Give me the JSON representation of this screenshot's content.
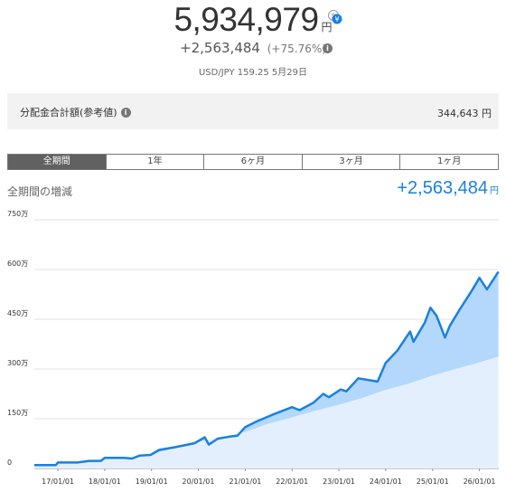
{
  "header": {
    "total_value": "5,934,979",
    "total_unit": "円",
    "gain": "+2,563,484",
    "gain_pct": "(+75.76%)",
    "fx_rate": "USD/JPY 159.25 5月29日",
    "currency_toggle_icon": "yen-dollar-toggle-icon",
    "info_icon": "info-icon"
  },
  "distribution": {
    "label": "分配金合計額(参考値)",
    "amount": "344,643 円"
  },
  "tabs": [
    {
      "label": "全期間",
      "active": true
    },
    {
      "label": "1年",
      "active": false
    },
    {
      "label": "6ヶ月",
      "active": false
    },
    {
      "label": "3ヶ月",
      "active": false
    },
    {
      "label": "1ヶ月",
      "active": false
    }
  ],
  "section": {
    "title": "全期間の増減",
    "value": "+2,563,484",
    "unit": "円"
  },
  "colors": {
    "accent": "#1a80e0",
    "line": "#1a80e0",
    "gain_fill": "#b3d8fb",
    "cost_fill": "#e3effc",
    "tab_active": "#616161"
  },
  "chart_data": {
    "type": "area",
    "y_ticks": [
      "750万",
      "600万",
      "450万",
      "300万",
      "150万",
      "0"
    ],
    "y_tick_values": [
      7500000,
      6000000,
      4500000,
      3000000,
      1500000,
      0
    ],
    "ylim": [
      0,
      7500000
    ],
    "x_ticks": [
      "17/01/01",
      "18/01/01",
      "19/01/01",
      "20/01/01",
      "21/01/01",
      "22/01/01",
      "23/01/01",
      "24/01/01",
      "25/01/01",
      "26/01/01"
    ],
    "x_range": [
      "2016-07-01",
      "2026-06-01"
    ],
    "grid": true,
    "series": [
      {
        "role": "valuation",
        "points": [
          [
            "2016-07-01",
            100000
          ],
          [
            "2016-12-15",
            100000
          ],
          [
            "2017-01-01",
            180000
          ],
          [
            "2017-06-01",
            180000
          ],
          [
            "2017-09-01",
            230000
          ],
          [
            "2017-12-01",
            230000
          ],
          [
            "2018-01-01",
            320000
          ],
          [
            "2018-06-01",
            320000
          ],
          [
            "2018-08-01",
            300000
          ],
          [
            "2018-10-01",
            390000
          ],
          [
            "2018-12-25",
            410000
          ],
          [
            "2019-03-01",
            560000
          ],
          [
            "2019-07-01",
            640000
          ],
          [
            "2019-12-01",
            760000
          ],
          [
            "2020-01-15",
            860000
          ],
          [
            "2020-02-20",
            940000
          ],
          [
            "2020-03-23",
            720000
          ],
          [
            "2020-06-01",
            900000
          ],
          [
            "2020-09-01",
            960000
          ],
          [
            "2020-11-01",
            990000
          ],
          [
            "2021-01-01",
            1250000
          ],
          [
            "2021-04-01",
            1420000
          ],
          [
            "2021-08-01",
            1620000
          ],
          [
            "2021-12-31",
            1850000
          ],
          [
            "2022-03-01",
            1760000
          ],
          [
            "2022-06-15",
            1980000
          ],
          [
            "2022-09-01",
            2250000
          ],
          [
            "2022-10-15",
            2150000
          ],
          [
            "2023-01-15",
            2380000
          ],
          [
            "2023-03-01",
            2330000
          ],
          [
            "2023-06-01",
            2720000
          ],
          [
            "2023-10-30",
            2620000
          ],
          [
            "2024-01-01",
            3180000
          ],
          [
            "2024-03-31",
            3550000
          ],
          [
            "2024-07-10",
            4130000
          ],
          [
            "2024-08-05",
            3820000
          ],
          [
            "2024-11-01",
            4400000
          ],
          [
            "2024-12-15",
            4850000
          ],
          [
            "2025-02-01",
            4600000
          ],
          [
            "2025-04-08",
            3950000
          ],
          [
            "2025-05-15",
            4300000
          ],
          [
            "2025-08-01",
            4800000
          ],
          [
            "2025-11-01",
            5350000
          ],
          [
            "2026-01-01",
            5750000
          ],
          [
            "2026-03-01",
            5400000
          ],
          [
            "2026-05-29",
            5934979
          ]
        ]
      },
      {
        "role": "principal",
        "points": [
          [
            "2016-07-01",
            100000
          ],
          [
            "2016-12-15",
            100000
          ],
          [
            "2017-01-01",
            180000
          ],
          [
            "2017-06-01",
            180000
          ],
          [
            "2017-09-01",
            230000
          ],
          [
            "2017-12-01",
            230000
          ],
          [
            "2018-01-01",
            320000
          ],
          [
            "2018-06-01",
            320000
          ],
          [
            "2018-09-01",
            330000
          ],
          [
            "2019-01-01",
            440000
          ],
          [
            "2019-07-01",
            610000
          ],
          [
            "2020-01-01",
            800000
          ],
          [
            "2020-07-01",
            950000
          ],
          [
            "2021-01-01",
            1100000
          ],
          [
            "2021-07-01",
            1350000
          ],
          [
            "2022-01-01",
            1540000
          ],
          [
            "2022-07-01",
            1740000
          ],
          [
            "2023-01-01",
            1920000
          ],
          [
            "2023-07-01",
            2120000
          ],
          [
            "2024-01-01",
            2370000
          ],
          [
            "2024-07-01",
            2560000
          ],
          [
            "2025-01-01",
            2800000
          ],
          [
            "2025-07-01",
            3000000
          ],
          [
            "2026-01-01",
            3200000
          ],
          [
            "2026-05-29",
            3371495
          ]
        ]
      }
    ]
  }
}
